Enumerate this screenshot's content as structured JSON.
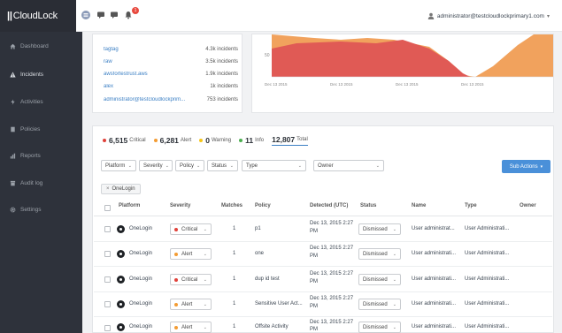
{
  "brand": {
    "name": "CloudLock"
  },
  "topbar": {
    "notification_count": "1",
    "user": "administrator@testcloudlockprimary1.com"
  },
  "sidebar": {
    "items": [
      {
        "label": "Dashboard",
        "icon": "home-icon"
      },
      {
        "label": "Incidents",
        "icon": "warning-icon",
        "active": true
      },
      {
        "label": "Activities",
        "icon": "activity-icon"
      },
      {
        "label": "Policies",
        "icon": "document-icon"
      },
      {
        "label": "Reports",
        "icon": "chart-icon"
      },
      {
        "label": "Audit log",
        "icon": "archive-icon"
      },
      {
        "label": "Settings",
        "icon": "gear-icon"
      }
    ]
  },
  "top_users": [
    {
      "user": "tagtag",
      "incidents": "4.3k incidents"
    },
    {
      "user": "raw",
      "incidents": "3.5k incidents"
    },
    {
      "user": "awsfortestrust.aws",
      "incidents": "1.9k incidents"
    },
    {
      "user": "alex",
      "incidents": "1k incidents"
    },
    {
      "user": "administrator@testcloudlockprim...",
      "incidents": "753 incidents"
    }
  ],
  "trend_chart": {
    "y_tick": "50",
    "x_labels": [
      "Dec 13 2015",
      "Dec 13 2015",
      "Dec 13 2015",
      "Dec 13 2015"
    ],
    "colors": {
      "critical": "#e05a55",
      "alert": "#f1a25d"
    }
  },
  "summary": {
    "critical": {
      "count": "6,515",
      "label": "Critical",
      "color": "#e0413a"
    },
    "alert": {
      "count": "6,281",
      "label": "Alert",
      "color": "#f39c33"
    },
    "warning": {
      "count": "0",
      "label": "Warning",
      "color": "#f5c518"
    },
    "info": {
      "count": "11",
      "label": "Info",
      "color": "#4caf50"
    },
    "total": {
      "count": "12,807",
      "label": "Total"
    }
  },
  "filters": {
    "platform": "Platform",
    "severity": "Severity",
    "policy": "Policy",
    "status": "Status",
    "type": "Type",
    "owner": "Owner"
  },
  "sub_actions_label": "Sub Actions",
  "active_filter_chip": "OneLogin",
  "table": {
    "headers": [
      "Platform",
      "Severity",
      "Matches",
      "Policy",
      "Detected (UTC)",
      "Status",
      "Name",
      "Type",
      "Owner"
    ],
    "rows": [
      {
        "platform": "OneLogin",
        "severity": "Critical",
        "severity_color": "#e0413a",
        "matches": "1",
        "policy": "p1",
        "detected_line1": "Dec 13, 2015 2:27",
        "detected_line2": "PM",
        "status": "Dismissed",
        "name": "User administrat...",
        "type": "User Administrati..."
      },
      {
        "platform": "OneLogin",
        "severity": "Alert",
        "severity_color": "#f39c33",
        "matches": "1",
        "policy": "one",
        "detected_line1": "Dec 13, 2015 2:27",
        "detected_line2": "PM",
        "status": "Dismissed",
        "name": "User administrati...",
        "type": "User Administrati..."
      },
      {
        "platform": "OneLogin",
        "severity": "Critical",
        "severity_color": "#e0413a",
        "matches": "1",
        "policy": "dup id test",
        "detected_line1": "Dec 13, 2015 2:27",
        "detected_line2": "PM",
        "status": "Dismissed",
        "name": "User administrati...",
        "type": "User Administrati..."
      },
      {
        "platform": "OneLogin",
        "severity": "Alert",
        "severity_color": "#f39c33",
        "matches": "1",
        "policy": "Sensitive User Act...",
        "detected_line1": "Dec 13, 2015 2:27",
        "detected_line2": "PM",
        "status": "Dismissed",
        "name": "User administrati...",
        "type": "User Administrati..."
      },
      {
        "platform": "OneLogin",
        "severity": "Alert",
        "severity_color": "#f39c33",
        "matches": "1",
        "policy": "Offsite Activity",
        "detected_line1": "Dec 13, 2015 2:27",
        "detected_line2": "PM",
        "status": "Dismissed",
        "name": "User administrati...",
        "type": "User Administrati..."
      }
    ]
  }
}
